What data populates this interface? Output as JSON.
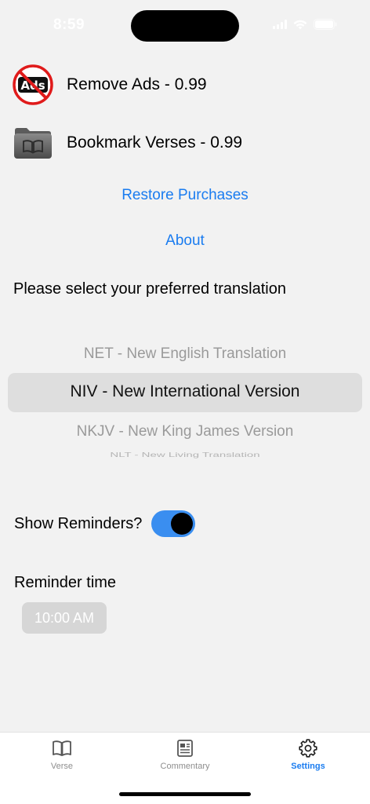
{
  "status_bar": {
    "time": "8:59"
  },
  "purchases": {
    "remove_ads": {
      "label": "Remove Ads - 0.99",
      "icon": "no-ads-icon",
      "icon_text": "Ads"
    },
    "bookmark_verses": {
      "label": "Bookmark Verses - 0.99",
      "icon": "book-folder-icon"
    }
  },
  "links": {
    "restore_purchases": "Restore Purchases",
    "about": "About"
  },
  "translation": {
    "prompt": "Please select your preferred translation",
    "options": [
      "NET - New English Translation",
      "NIV - New International Version",
      "NKJV - New King James Version",
      "NLT - New Living Translation"
    ],
    "selected": "NIV - New International Version"
  },
  "reminders": {
    "label": "Show Reminders?",
    "enabled": true,
    "time_label": "Reminder time",
    "time_value": "10:00 AM"
  },
  "tab_bar": {
    "tabs": [
      {
        "label": "Verse",
        "icon": "book-icon",
        "active": false
      },
      {
        "label": "Commentary",
        "icon": "newspaper-icon",
        "active": false
      },
      {
        "label": "Settings",
        "icon": "gear-icon",
        "active": true
      }
    ]
  },
  "colors": {
    "accent": "#1a7cf0",
    "toggle_on": "#3a8ef0",
    "background": "#f2f2f2",
    "no_ads_red": "#e01b1b"
  }
}
